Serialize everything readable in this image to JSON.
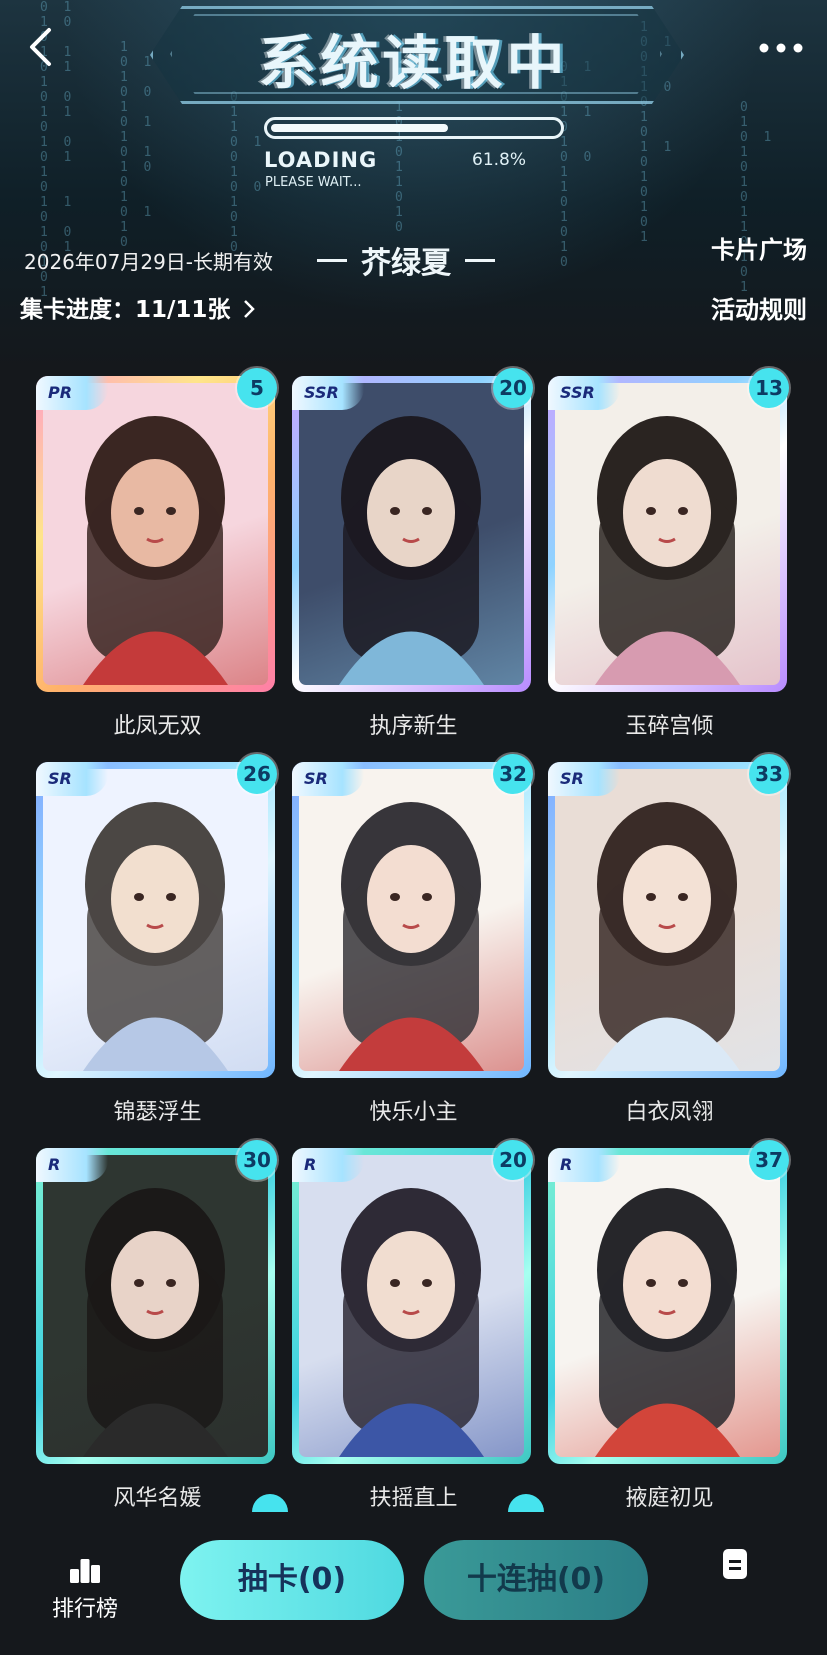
{
  "header": {
    "title": "系统读取中",
    "loading_label": "LOADING",
    "loading_sub": "PLEASE WAIT...",
    "loading_percent_text": "61.8%",
    "loading_progress": 0.618
  },
  "event": {
    "date_text": "2026年07月29日-长期有效",
    "theme_title": "芥绿夏",
    "progress_text": "集卡进度：11/11张",
    "card_square_label": "卡片广场",
    "rules_label": "活动规则"
  },
  "cards": [
    {
      "name": "此凤无双",
      "rarity": "PR",
      "count": "5"
    },
    {
      "name": "执序新生",
      "rarity": "SSR",
      "count": "20"
    },
    {
      "name": "玉碎宫倾",
      "rarity": "SSR",
      "count": "13"
    },
    {
      "name": "锦瑟浮生",
      "rarity": "SR",
      "count": "26"
    },
    {
      "name": "快乐小主",
      "rarity": "SR",
      "count": "32"
    },
    {
      "name": "白衣凤翎",
      "rarity": "SR",
      "count": "33"
    },
    {
      "name": "风华名媛",
      "rarity": "R",
      "count": "30"
    },
    {
      "name": "扶摇直上",
      "rarity": "R",
      "count": "20"
    },
    {
      "name": "掖庭初见",
      "rarity": "R",
      "count": "37"
    }
  ],
  "bottom": {
    "ranking_label": "排行榜",
    "draw_label": "抽卡(0)",
    "draw10_label": "十连抽(0)"
  },
  "icons": {
    "back": "back-arrow-icon",
    "more": "more-dots-icon",
    "ranking": "podium-icon",
    "notes": "notes-icon"
  },
  "colors": {
    "accent": "#46e3ee",
    "draw_button": "#5ce6e6",
    "draw10_button": "#2f8e8e",
    "background": "#15181c"
  }
}
